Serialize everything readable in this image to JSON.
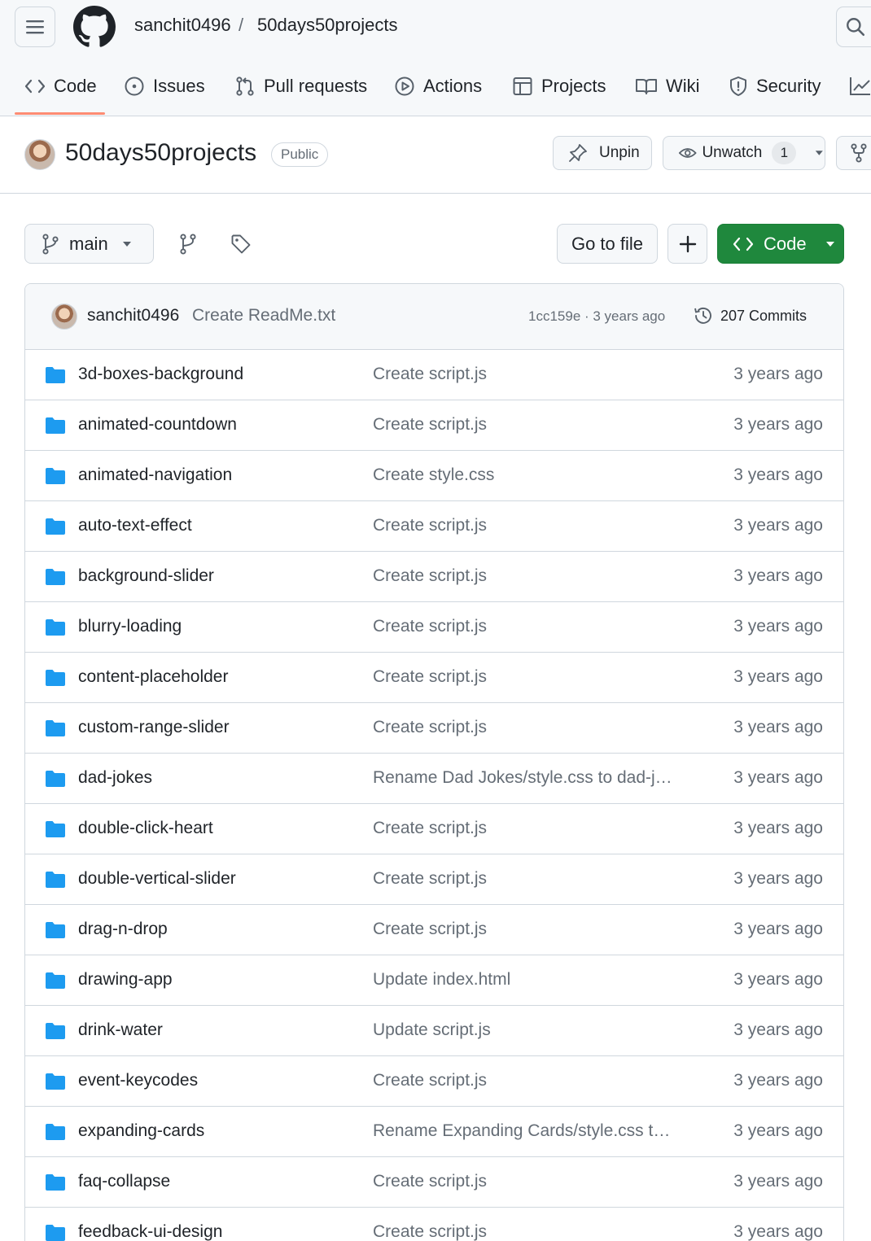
{
  "header": {
    "owner": "sanchit0496",
    "separator": "/",
    "repo": "50days50projects"
  },
  "tabs": [
    {
      "label": "Code",
      "icon": "code-icon"
    },
    {
      "label": "Issues",
      "icon": "issue-icon"
    },
    {
      "label": "Pull requests",
      "icon": "pull-request-icon"
    },
    {
      "label": "Actions",
      "icon": "play-icon"
    },
    {
      "label": "Projects",
      "icon": "table-icon"
    },
    {
      "label": "Wiki",
      "icon": "book-icon"
    },
    {
      "label": "Security",
      "icon": "shield-icon"
    }
  ],
  "repo": {
    "name": "50days50projects",
    "visibility": "Public",
    "unpin_label": "Unpin",
    "watch_label": "Unwatch",
    "watch_count": "1"
  },
  "toolbar": {
    "branch": "main",
    "go_to_file": "Go to file",
    "code_label": "Code"
  },
  "latest_commit": {
    "author": "sanchit0496",
    "message": "Create ReadMe.txt",
    "meta": "1cc159e · 3 years ago",
    "commits": "207 Commits"
  },
  "colors": {
    "accent_green": "#1f883d",
    "folder_blue": "#1d9bf0",
    "tab_underline": "#fd8c73"
  },
  "files": [
    {
      "name": "3d-boxes-background",
      "message": "Create script.js",
      "date": "3 years ago"
    },
    {
      "name": "animated-countdown",
      "message": "Create script.js",
      "date": "3 years ago"
    },
    {
      "name": "animated-navigation",
      "message": "Create style.css",
      "date": "3 years ago"
    },
    {
      "name": "auto-text-effect",
      "message": "Create script.js",
      "date": "3 years ago"
    },
    {
      "name": "background-slider",
      "message": "Create script.js",
      "date": "3 years ago"
    },
    {
      "name": "blurry-loading",
      "message": "Create script.js",
      "date": "3 years ago"
    },
    {
      "name": "content-placeholder",
      "message": "Create script.js",
      "date": "3 years ago"
    },
    {
      "name": "custom-range-slider",
      "message": "Create script.js",
      "date": "3 years ago"
    },
    {
      "name": "dad-jokes",
      "message": "Rename Dad Jokes/style.css to dad-j…",
      "date": "3 years ago"
    },
    {
      "name": "double-click-heart",
      "message": "Create script.js",
      "date": "3 years ago"
    },
    {
      "name": "double-vertical-slider",
      "message": "Create script.js",
      "date": "3 years ago"
    },
    {
      "name": "drag-n-drop",
      "message": "Create script.js",
      "date": "3 years ago"
    },
    {
      "name": "drawing-app",
      "message": "Update index.html",
      "date": "3 years ago"
    },
    {
      "name": "drink-water",
      "message": "Update script.js",
      "date": "3 years ago"
    },
    {
      "name": "event-keycodes",
      "message": "Create script.js",
      "date": "3 years ago"
    },
    {
      "name": "expanding-cards",
      "message": "Rename Expanding Cards/style.css t…",
      "date": "3 years ago"
    },
    {
      "name": "faq-collapse",
      "message": "Create script.js",
      "date": "3 years ago"
    },
    {
      "name": "feedback-ui-design",
      "message": "Create script.js",
      "date": "3 years ago"
    }
  ]
}
